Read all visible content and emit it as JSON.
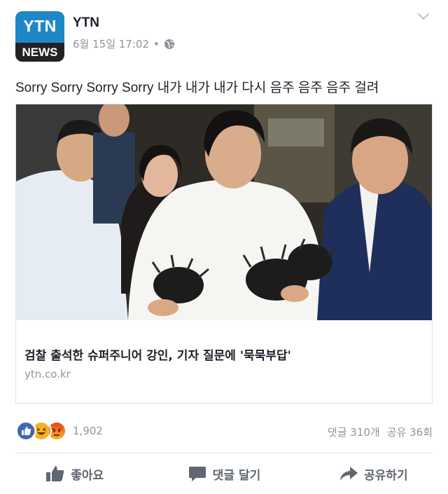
{
  "page": {
    "name": "YTN",
    "timestamp": "6월 15일 17:02",
    "separator": "•",
    "logo_top": "YTN",
    "logo_bottom": "NEWS"
  },
  "post": {
    "text": "Sorry Sorry Sorry Sorry 내가 내가 내가 다시 음주 음주 음주 걸려"
  },
  "link": {
    "headline": "검찰 출석한 슈퍼주니어 강인, 기자 질문에 '묵묵부답'",
    "domain": "ytn.co.kr"
  },
  "reactions": {
    "icons": [
      "like-icon",
      "haha-icon",
      "angry-icon"
    ],
    "count": "1,902",
    "comments": "댓글 310개",
    "shares": "공유 36회"
  },
  "actions": {
    "like": "좋아요",
    "comment": "댓글 달기",
    "share": "공유하기"
  },
  "colors": {
    "brand": "#1e88c7",
    "like": "#4267b2",
    "haha": "#f7b125",
    "angry": "#e9710f",
    "muted": "#90949c"
  }
}
